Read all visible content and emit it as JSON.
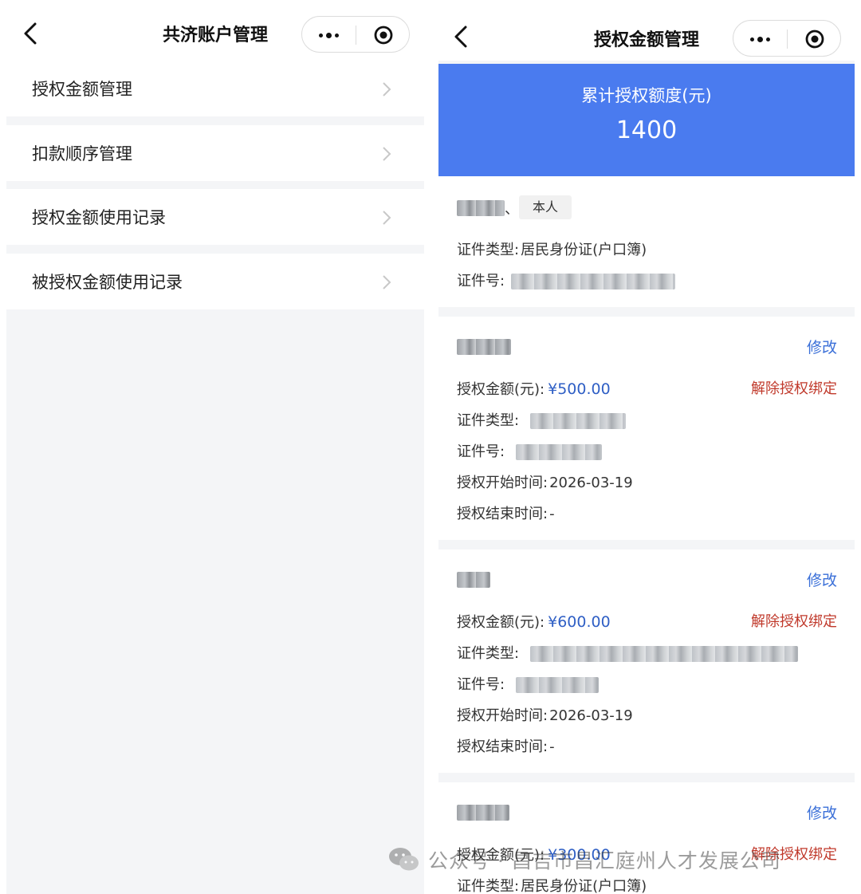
{
  "left_screen": {
    "nav": {
      "title": "共济账户管理"
    },
    "menu": [
      {
        "label": "授权金额管理"
      },
      {
        "label": "扣款顺序管理"
      },
      {
        "label": "授权金额使用记录"
      },
      {
        "label": "被授权金额使用记录"
      }
    ]
  },
  "right_screen": {
    "nav": {
      "title": "授权金额管理"
    },
    "summary": {
      "label": "累计授权额度(元)",
      "value": "1400"
    },
    "self_card": {
      "name_suffix": "、",
      "tag": "本人",
      "id_type_label": "证件类型:",
      "id_type_value": "居民身份证(户口簿)",
      "id_no_label": "证件号:"
    },
    "auth_cards": [
      {
        "edit_label": "修改",
        "amount_label": "授权金额(元):",
        "amount": "¥500.00",
        "unbind_label": "解除授权绑定",
        "id_type_label": "证件类型:",
        "id_no_label": "证件号:",
        "start_label": "授权开始时间:",
        "start_value": "2026-03-19",
        "end_label": "授权结束时间:",
        "end_value": "-"
      },
      {
        "edit_label": "修改",
        "amount_label": "授权金额(元):",
        "amount": "¥600.00",
        "unbind_label": "解除授权绑定",
        "id_type_label": "证件类型:",
        "id_no_label": "证件号:",
        "start_label": "授权开始时间:",
        "start_value": "2026-03-19",
        "end_label": "授权结束时间:",
        "end_value": "-"
      },
      {
        "edit_label": "修改",
        "amount_label": "授权金额(元):",
        "amount": "¥300.00",
        "unbind_label": "解除授权绑定",
        "id_type_label": "证件类型:",
        "id_type_value": "居民身份证(户口簿)"
      }
    ]
  },
  "watermark": {
    "text": "公众号 · 昌吉市昌汇庭州人才发展公司"
  },
  "icons": {
    "back": "chevron-left-icon",
    "more": "more-dots-icon",
    "close": "miniprogram-close-icon",
    "arrow": "chevron-right-icon",
    "wechat": "wechat-logo-icon"
  },
  "colors": {
    "accent": "#4a7bef",
    "link": "#3a6fd8",
    "danger": "#c0392b",
    "amount": "#2f5fc5",
    "background": "#f4f5f7"
  }
}
